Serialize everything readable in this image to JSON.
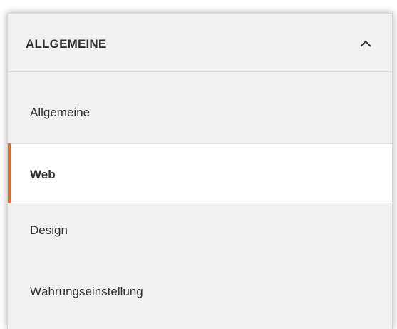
{
  "section": {
    "title": "ALLGEMEINE",
    "expanded": true,
    "toggle_icon": "chevron-up-icon"
  },
  "nav": {
    "items": [
      {
        "label": "Allgemeine",
        "active": false
      },
      {
        "label": "Web",
        "active": true
      },
      {
        "label": "Design",
        "active": false
      },
      {
        "label": "Währungseinstellung",
        "active": false
      }
    ]
  },
  "colors": {
    "panel_background": "#f1f1f1",
    "active_item_background": "#ffffff",
    "active_indicator": "#e26a28",
    "text": "#303030",
    "divider": "#dcdcdc"
  }
}
